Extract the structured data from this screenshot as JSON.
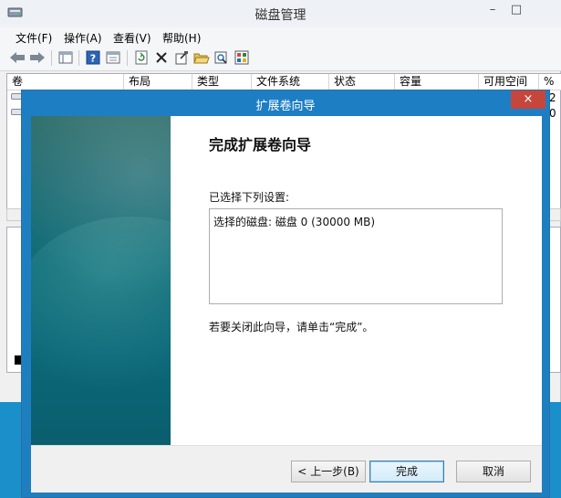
{
  "window": {
    "title": "磁盘管理",
    "controls": [
      "–",
      "□"
    ]
  },
  "menu": {
    "items": [
      "文件(F)",
      "操作(A)",
      "查看(V)",
      "帮助(H)"
    ]
  },
  "table": {
    "columns": [
      "卷",
      "布局",
      "类型",
      "文件系统",
      "状态",
      "容量",
      "可用空间",
      "%"
    ],
    "partial_right_values": [
      "2",
      "0"
    ]
  },
  "wizard": {
    "title": "扩展卷向导",
    "close_glyph": "×",
    "heading": "完成扩展卷向导",
    "settings_label": "已选择下列设置:",
    "settings_text": "选择的磁盘: 磁盘 0 (30000 MB)",
    "close_hint": "若要关闭此向导，请单击“完成”。",
    "buttons": {
      "back": "< 上一步(B)",
      "finish": "完成",
      "cancel": "取消"
    }
  }
}
